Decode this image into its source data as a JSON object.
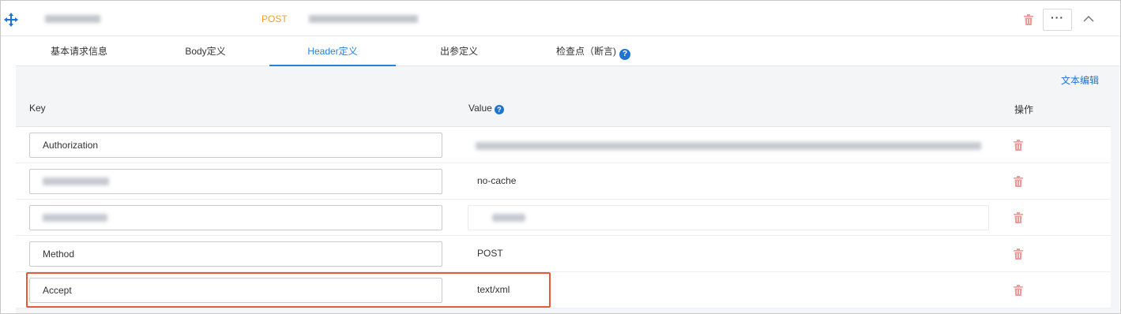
{
  "header": {
    "method": "POST",
    "more_label": "···"
  },
  "tabs": [
    {
      "label": "基本请求信息",
      "active": false
    },
    {
      "label": "Body定义",
      "active": false
    },
    {
      "label": "Header定义",
      "active": true
    },
    {
      "label": "出参定义",
      "active": false
    },
    {
      "label": "检查点（断言)",
      "active": false
    }
  ],
  "toolbar": {
    "text_edit_label": "文本编辑"
  },
  "table": {
    "columns": [
      "Key",
      "Value",
      "操作"
    ],
    "rows": [
      {
        "key": "Authorization",
        "value": ""
      },
      {
        "key": "",
        "value": "no-cache"
      },
      {
        "key": "",
        "value": ""
      },
      {
        "key": "Method",
        "value": "POST"
      },
      {
        "key": "Accept",
        "value": "text/xml"
      }
    ]
  },
  "colors": {
    "accent": "#2a7fd8",
    "method": "#f0a030",
    "delete": "#e57373",
    "highlight": "#e65a35"
  },
  "icons": {
    "move": "move-arrows-icon",
    "delete": "trash-icon",
    "collapse": "chevron-up-icon",
    "help": "question-circle-icon"
  }
}
